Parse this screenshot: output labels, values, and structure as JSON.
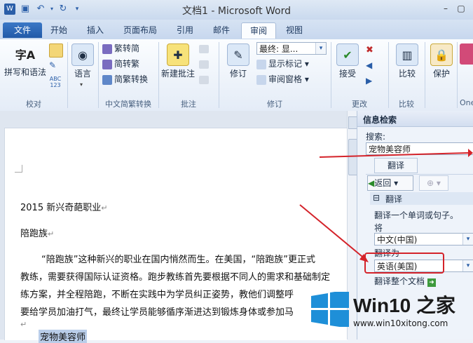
{
  "window": {
    "title": "文档1 - Microsoft Word"
  },
  "tabs": [
    "文件",
    "开始",
    "插入",
    "页面布局",
    "引用",
    "邮件",
    "审阅",
    "视图"
  ],
  "ribbon": {
    "spelling": "拼写和语法",
    "language": "语言",
    "trad_to_simp": "繁转简",
    "simp_to_trad": "简转繁",
    "convert": "简繁转换",
    "new_comment": "新建批注",
    "track": "修订",
    "final_display": "最终: 显...",
    "show_markup": "显示标记",
    "review_pane": "审阅窗格",
    "accept": "接受",
    "compare": "比较",
    "protect": "保护",
    "partial": "One",
    "groups": {
      "proofing": "校对",
      "chinese_conversion": "中文简繁转换",
      "comments": "批注",
      "tracking": "修订",
      "changes": "更改",
      "compare": "比较"
    }
  },
  "document": {
    "lines": [
      "2015 新兴奇葩职业",
      "陪跑族",
      "“陪跑族”这种新兴的职业在国内悄然而生。在美国，“陪跑族”更正式",
      "教练，需要获得国际认证资格。跑步教练首先要根据不同人的需求和基础制定",
      "练方案，并全程陪跑，不断在实践中为学员纠正姿势，教他们调整呼",
      "要给学员加油打气，最终让学员能够循序渐进达到锻炼身体或参加马",
      "宠物美容师"
    ],
    "para_mark": "↵"
  },
  "research_pane": {
    "title": "信息检索",
    "search_label": "搜索:",
    "search_value": "宠物美容师",
    "translate_button": "翻译",
    "back_button": "返回",
    "section_title": "翻译",
    "hint": "翻译一个单词或句子。",
    "from_label": "将",
    "from_value": "中文(中国)",
    "to_label": "翻译为",
    "to_value": "英语(美国)",
    "translate_doc": "翻译整个文档"
  },
  "watermark": {
    "brand": "Win10 之家",
    "url": "www.win10xitong.com"
  },
  "colors": {
    "file_tab": "#2b63b0",
    "annotation_red": "#d4232a",
    "win_logo": "#1e8fd8"
  }
}
